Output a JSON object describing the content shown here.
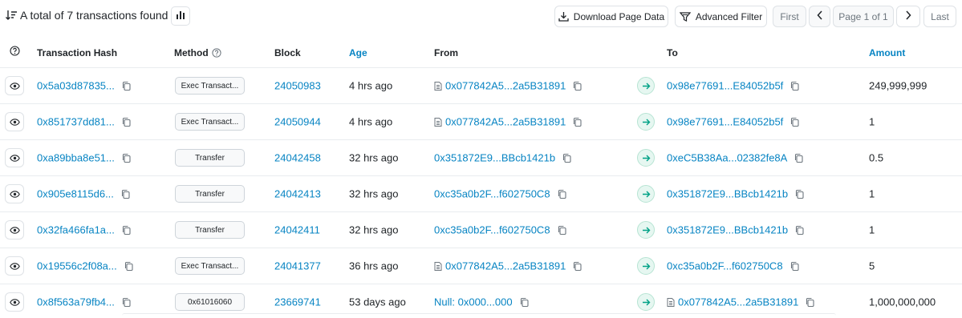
{
  "summary": {
    "text": "A total of 7 transactions found"
  },
  "toolbar": {
    "download_label": "Download Page Data",
    "filter_label": "Advanced Filter",
    "first_label": "First",
    "page_label": "Page 1 of 1",
    "last_label": "Last"
  },
  "columns": {
    "hash": "Transaction Hash",
    "method": "Method",
    "block": "Block",
    "age": "Age",
    "from": "From",
    "to": "To",
    "amount": "Amount"
  },
  "colors": {
    "link": "#0784c3",
    "arrow_bg": "#e6f7f1",
    "arrow_fg": "#00a186"
  },
  "rows": [
    {
      "hash": "0x5a03d87835...",
      "method": "Exec Transact...",
      "block": "24050983",
      "age": "4 hrs ago",
      "from": "0x077842A5...2a5B31891",
      "from_contract": true,
      "to": "0x98e77691...E84052b5f",
      "to_contract": false,
      "amount": "249,999,999"
    },
    {
      "hash": "0x851737dd81...",
      "method": "Exec Transact...",
      "block": "24050944",
      "age": "4 hrs ago",
      "from": "0x077842A5...2a5B31891",
      "from_contract": true,
      "to": "0x98e77691...E84052b5f",
      "to_contract": false,
      "amount": "1"
    },
    {
      "hash": "0xa89bba8e51...",
      "method": "Transfer",
      "block": "24042458",
      "age": "32 hrs ago",
      "from": "0x351872E9...BBcb1421b",
      "from_contract": false,
      "to": "0xeC5B38Aa...02382fe8A",
      "to_contract": false,
      "amount": "0.5"
    },
    {
      "hash": "0x905e8115d6...",
      "method": "Transfer",
      "block": "24042413",
      "age": "32 hrs ago",
      "from": "0xc35a0b2F...f602750C8",
      "from_contract": false,
      "to": "0x351872E9...BBcb1421b",
      "to_contract": false,
      "amount": "1"
    },
    {
      "hash": "0x32fa466fa1a...",
      "method": "Transfer",
      "block": "24042411",
      "age": "32 hrs ago",
      "from": "0xc35a0b2F...f602750C8",
      "from_contract": false,
      "to": "0x351872E9...BBcb1421b",
      "to_contract": false,
      "amount": "1"
    },
    {
      "hash": "0x19556c2f08a...",
      "method": "Exec Transact...",
      "block": "24041377",
      "age": "36 hrs ago",
      "from": "0x077842A5...2a5B31891",
      "from_contract": true,
      "to": "0xc35a0b2F...f602750C8",
      "to_contract": false,
      "amount": "5"
    },
    {
      "hash": "0x8f563a79fb4...",
      "method": "0x61016060",
      "block": "23669741",
      "age": "53 days ago",
      "from": "Null: 0x000...000",
      "from_contract": false,
      "to": "0x077842A5...2a5B31891",
      "to_contract": true,
      "amount": "1,000,000,000"
    }
  ]
}
